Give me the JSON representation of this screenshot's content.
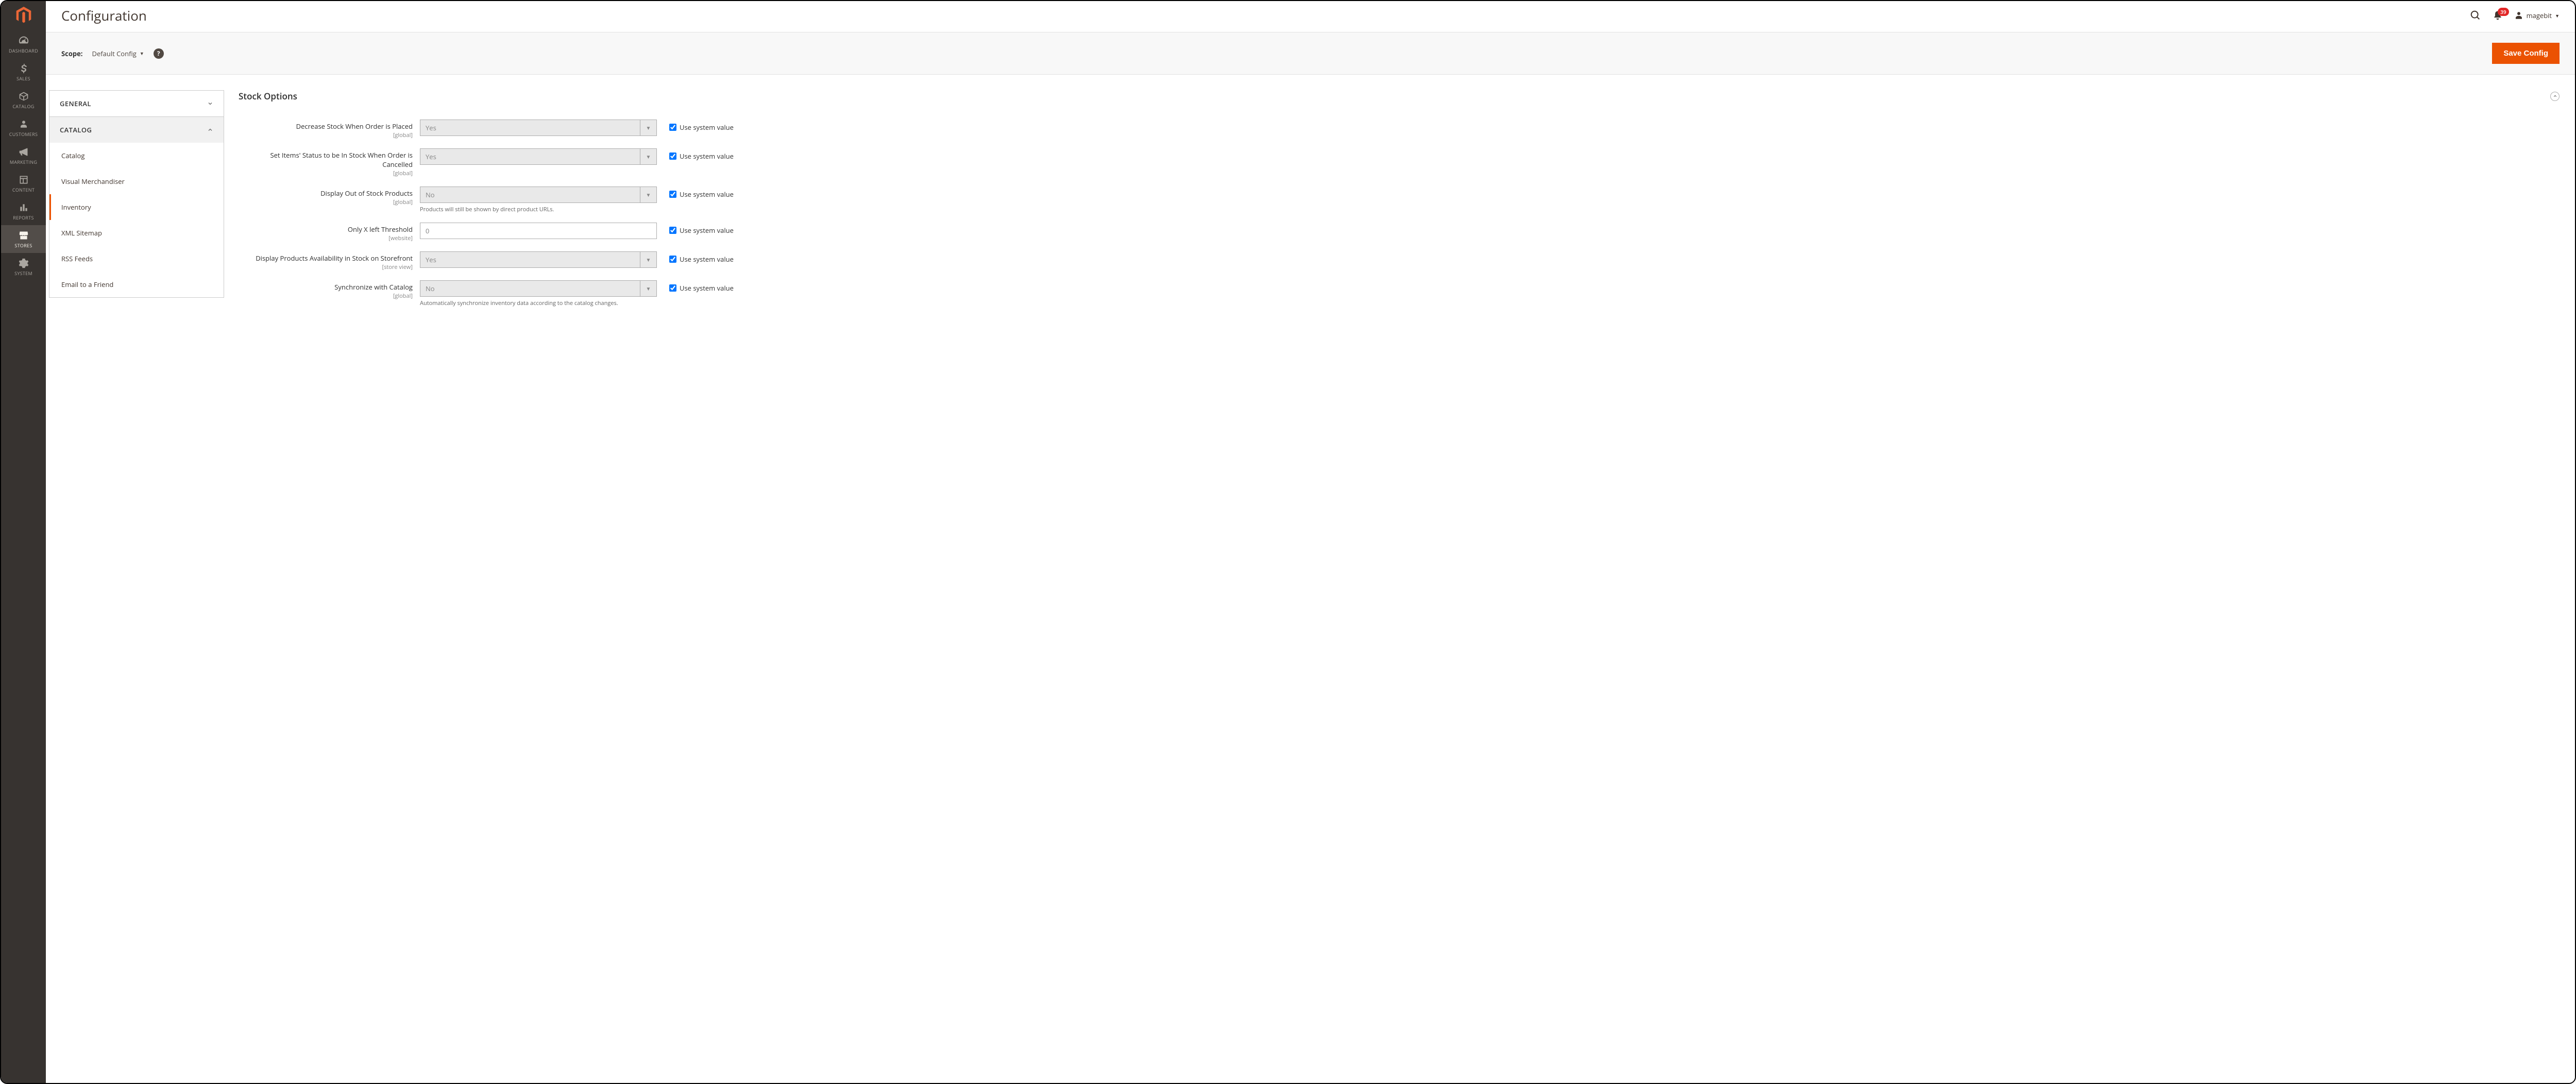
{
  "header": {
    "title": "Configuration",
    "notification_count": "39",
    "user_name": "magebit"
  },
  "sidebar": {
    "items": [
      {
        "label": "DASHBOARD"
      },
      {
        "label": "SALES"
      },
      {
        "label": "CATALOG"
      },
      {
        "label": "CUSTOMERS"
      },
      {
        "label": "MARKETING"
      },
      {
        "label": "CONTENT"
      },
      {
        "label": "REPORTS"
      },
      {
        "label": "STORES"
      },
      {
        "label": "SYSTEM"
      }
    ]
  },
  "scope": {
    "label": "Scope:",
    "value": "Default Config",
    "save_label": "Save Config"
  },
  "tabs": {
    "groups": [
      {
        "label": "GENERAL",
        "expanded": false
      },
      {
        "label": "CATALOG",
        "expanded": true,
        "items": [
          {
            "label": "Catalog"
          },
          {
            "label": "Visual Merchandiser"
          },
          {
            "label": "Inventory",
            "active": true
          },
          {
            "label": "XML Sitemap"
          },
          {
            "label": "RSS Feeds"
          },
          {
            "label": "Email to a Friend"
          }
        ]
      }
    ]
  },
  "section": {
    "title": "Stock Options",
    "use_system_label": "Use system value",
    "fields": [
      {
        "label": "Decrease Stock When Order is Placed",
        "scope": "[global]",
        "value": "Yes",
        "type": "select"
      },
      {
        "label": "Set Items' Status to be In Stock When Order is Cancelled",
        "scope": "[global]",
        "value": "Yes",
        "type": "select"
      },
      {
        "label": "Display Out of Stock Products",
        "scope": "[global]",
        "value": "No",
        "type": "select",
        "note": "Products will still be shown by direct product URLs."
      },
      {
        "label": "Only X left Threshold",
        "scope": "[website]",
        "value": "0",
        "type": "text"
      },
      {
        "label": "Display Products Availability in Stock on Storefront",
        "scope": "[store view]",
        "value": "Yes",
        "type": "select"
      },
      {
        "label": "Synchronize with Catalog",
        "scope": "[global]",
        "value": "No",
        "type": "select",
        "note": "Automatically synchronize inventory data according to the catalog changes."
      }
    ]
  }
}
